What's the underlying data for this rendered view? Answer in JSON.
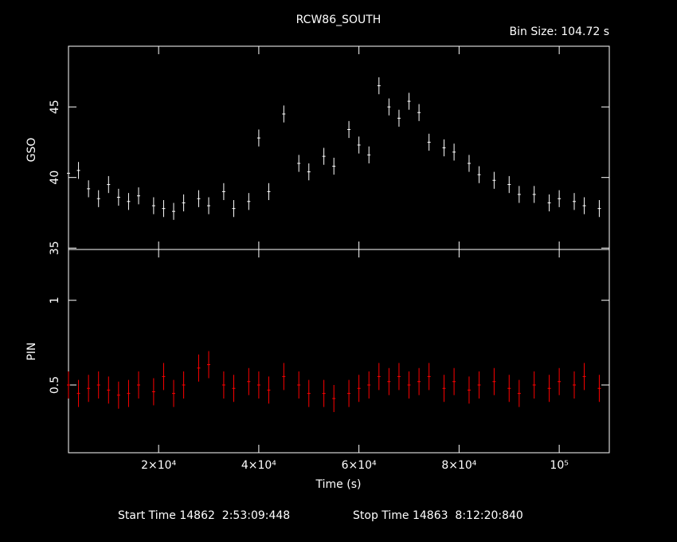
{
  "chart_data": [
    {
      "type": "scatter",
      "panel": "top",
      "title": "RCW86_SOUTH",
      "subtitle": "Bin Size: 104.72 s",
      "xlabel": "Time (s)",
      "ylabel": "GSO",
      "xlim": [
        2000,
        110000
      ],
      "ylim": [
        34.9,
        49.3
      ],
      "yticks": [
        {
          "v": 35,
          "label": "35"
        },
        {
          "v": 40,
          "label": "40"
        },
        {
          "v": 45,
          "label": "45"
        }
      ],
      "series": [
        {
          "color": "#ffffff",
          "x": [
            2000,
            4000,
            6000,
            8000,
            10000,
            12000,
            14000,
            16000,
            19000,
            21000,
            23000,
            25000,
            28000,
            30000,
            33000,
            35000,
            38000,
            40000,
            42000,
            45000,
            48000,
            50000,
            53000,
            55000,
            58000,
            60000,
            62000,
            64000,
            66000,
            68000,
            70000,
            72000,
            74000,
            77000,
            79000,
            82000,
            84000,
            87000,
            90000,
            92000,
            95000,
            98000,
            100000,
            103000,
            105000,
            108000
          ],
          "y": [
            40.3,
            40.5,
            39.2,
            38.5,
            39.5,
            38.6,
            38.3,
            38.7,
            38.0,
            37.8,
            37.6,
            38.2,
            38.5,
            38.0,
            39.0,
            37.8,
            38.3,
            42.8,
            39.0,
            44.5,
            41.0,
            40.4,
            41.5,
            40.8,
            43.4,
            42.3,
            41.6,
            46.5,
            45.0,
            44.2,
            45.4,
            44.6,
            42.5,
            42.1,
            41.8,
            41.0,
            40.2,
            39.8,
            39.5,
            38.8,
            38.8,
            38.2,
            38.5,
            38.3,
            38.0,
            37.8
          ],
          "err": [
            0.6,
            0.6,
            0.6,
            0.6,
            0.6,
            0.6,
            0.6,
            0.6,
            0.6,
            0.6,
            0.6,
            0.6,
            0.6,
            0.6,
            0.6,
            0.6,
            0.6,
            0.6,
            0.6,
            0.6,
            0.6,
            0.6,
            0.6,
            0.6,
            0.6,
            0.6,
            0.6,
            0.6,
            0.6,
            0.6,
            0.6,
            0.6,
            0.6,
            0.6,
            0.6,
            0.6,
            0.6,
            0.6,
            0.6,
            0.6,
            0.6,
            0.6,
            0.6,
            0.6,
            0.6,
            0.6
          ]
        }
      ]
    },
    {
      "type": "scatter",
      "panel": "bottom",
      "xlabel": "Time (s)",
      "ylabel": "PIN",
      "xlim": [
        2000,
        110000
      ],
      "ylim": [
        0.1,
        1.3
      ],
      "yticks": [
        {
          "v": 0.5,
          "label": "0.5"
        },
        {
          "v": 1,
          "label": "1"
        }
      ],
      "xticks": [
        {
          "v": 20000,
          "label": "2×10⁴"
        },
        {
          "v": 40000,
          "label": "4×10⁴"
        },
        {
          "v": 60000,
          "label": "6×10⁴"
        },
        {
          "v": 80000,
          "label": "8×10⁴"
        },
        {
          "v": 100000,
          "label": "10⁵"
        }
      ],
      "series": [
        {
          "color": "#ff0000",
          "x": [
            2000,
            4000,
            6000,
            8000,
            10000,
            12000,
            14000,
            16000,
            19000,
            21000,
            23000,
            25000,
            28000,
            30000,
            33000,
            35000,
            38000,
            40000,
            42000,
            45000,
            48000,
            50000,
            53000,
            55000,
            58000,
            60000,
            62000,
            64000,
            66000,
            68000,
            70000,
            72000,
            74000,
            77000,
            79000,
            82000,
            84000,
            87000,
            90000,
            92000,
            95000,
            98000,
            100000,
            103000,
            105000,
            108000
          ],
          "y": [
            0.5,
            0.45,
            0.48,
            0.5,
            0.47,
            0.44,
            0.45,
            0.5,
            0.46,
            0.55,
            0.45,
            0.5,
            0.6,
            0.62,
            0.5,
            0.48,
            0.52,
            0.5,
            0.47,
            0.55,
            0.5,
            0.45,
            0.45,
            0.42,
            0.45,
            0.48,
            0.5,
            0.55,
            0.52,
            0.55,
            0.5,
            0.52,
            0.55,
            0.48,
            0.52,
            0.47,
            0.5,
            0.52,
            0.48,
            0.45,
            0.5,
            0.48,
            0.52,
            0.5,
            0.55,
            0.48
          ],
          "err": [
            0.08,
            0.08,
            0.08,
            0.08,
            0.08,
            0.08,
            0.08,
            0.08,
            0.08,
            0.08,
            0.08,
            0.08,
            0.08,
            0.08,
            0.08,
            0.08,
            0.08,
            0.08,
            0.08,
            0.08,
            0.08,
            0.08,
            0.08,
            0.08,
            0.08,
            0.08,
            0.08,
            0.08,
            0.08,
            0.08,
            0.08,
            0.08,
            0.08,
            0.08,
            0.08,
            0.08,
            0.08,
            0.08,
            0.08,
            0.08,
            0.08,
            0.08,
            0.08,
            0.08,
            0.08,
            0.08
          ]
        }
      ]
    }
  ],
  "footer": {
    "start_time": "Start Time 14862  2:53:09:448",
    "stop_time": "Stop Time 14863  8:12:20:840"
  }
}
